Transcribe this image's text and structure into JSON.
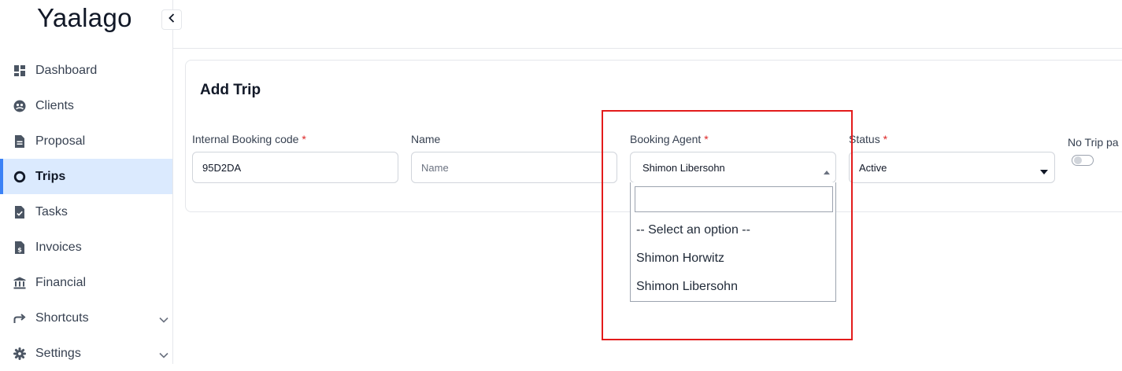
{
  "app": {
    "brand": "Yaalago"
  },
  "sidebar": {
    "items": [
      {
        "label": "Dashboard",
        "icon": "dashboard-icon"
      },
      {
        "label": "Clients",
        "icon": "clients-icon"
      },
      {
        "label": "Proposal",
        "icon": "document-icon"
      },
      {
        "label": "Trips",
        "icon": "circle-icon",
        "active": true
      },
      {
        "label": "Tasks",
        "icon": "task-icon"
      },
      {
        "label": "Invoices",
        "icon": "invoice-icon"
      },
      {
        "label": "Financial",
        "icon": "bank-icon"
      },
      {
        "label": "Shortcuts",
        "icon": "share-arrow-icon",
        "expandable": true
      },
      {
        "label": "Settings",
        "icon": "gear-icon",
        "expandable": true
      }
    ]
  },
  "form": {
    "title": "Add Trip",
    "required_mark": "*",
    "booking_code": {
      "label": "Internal Booking code",
      "value": "95D2DA"
    },
    "name": {
      "label": "Name",
      "placeholder": "Name"
    },
    "booking_agent": {
      "label": "Booking Agent",
      "value": "Shimon Libersohn",
      "options": [
        "-- Select an option --",
        "Shimon Horwitz",
        "Shimon Libersohn"
      ]
    },
    "status": {
      "label": "Status",
      "value": "Active"
    },
    "no_trip": {
      "label": "No Trip pa"
    }
  },
  "colors": {
    "accent": "#3b82f6",
    "active_bg": "#dbeafe",
    "required": "#dc2626",
    "highlight": "#e31b1b"
  }
}
